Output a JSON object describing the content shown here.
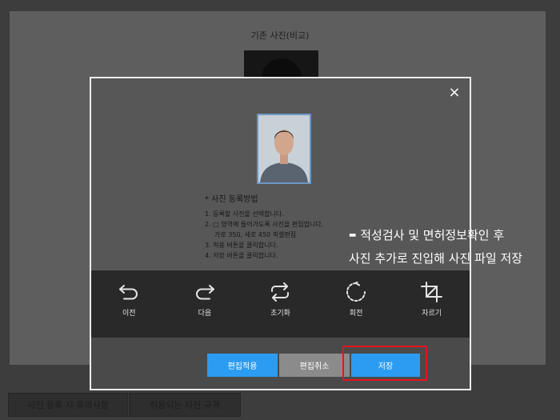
{
  "background": {
    "title": "기존 사진(비교)",
    "buttons": [
      "사진 등록 시 유의사항",
      "허용되는 사진 규격"
    ]
  },
  "modal": {
    "close_icon": "×",
    "instructions": {
      "heading": "* 사진 등록방법",
      "lines": [
        "1. 등록할 사진을 선택합니다.",
        "2. □ 영역에 들어가도록 사진을 편집합니다.",
        "가로 350, 세로 450 픽셀편집",
        "3. 적용 버튼을 클릭합니다.",
        "4. 저장 버튼을 클릭합니다."
      ]
    },
    "tools": [
      {
        "icon": "undo-icon",
        "label": "이전"
      },
      {
        "icon": "redo-icon",
        "label": "다음"
      },
      {
        "icon": "reset-icon",
        "label": "초기화"
      },
      {
        "icon": "rotate-icon",
        "label": "회전"
      },
      {
        "icon": "crop-icon",
        "label": "자르기"
      }
    ],
    "buttons": {
      "apply": "편집적용",
      "cancel": "편집취소",
      "save": "저장"
    }
  },
  "caption": {
    "marker": "▬",
    "line1": "적성검사 및 면허정보확인 후",
    "line2": "사진 추가로 진입해 사진 파일 저장"
  },
  "colors": {
    "apply": "#2c9cf2",
    "cancel": "#8b8b8b",
    "save": "#2c9cf2",
    "highlight": "#e8131b",
    "photo_border": "#6d96c2"
  }
}
